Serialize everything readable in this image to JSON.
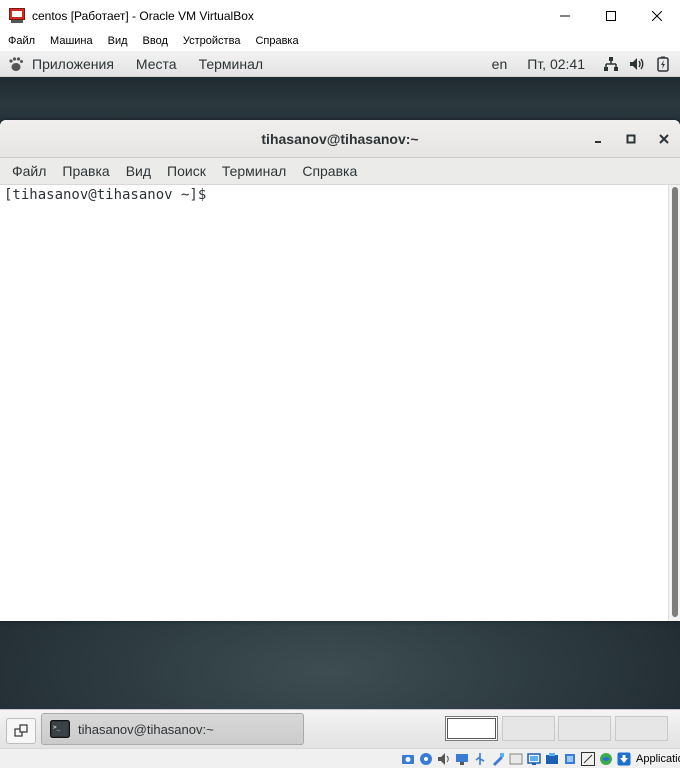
{
  "host_window": {
    "title": "centos [Работает] - Oracle VM VirtualBox",
    "menu": [
      "Файл",
      "Машина",
      "Вид",
      "Ввод",
      "Устройства",
      "Справка"
    ]
  },
  "gnome_top_panel": {
    "menu": [
      "Приложения",
      "Места",
      "Терминал"
    ],
    "language": "en",
    "clock": "Пт, 02:41",
    "status_icons": [
      "network-icon",
      "volume-icon",
      "power-icon"
    ]
  },
  "terminal": {
    "title": "tihasanov@tihasanov:~",
    "menu": [
      "Файл",
      "Правка",
      "Вид",
      "Поиск",
      "Терминал",
      "Справка"
    ],
    "prompt": "[tihasanov@tihasanov ~]$ "
  },
  "gnome_bottom_panel": {
    "task_label": "tihasanov@tihasanov:~",
    "workspace_active": 1,
    "workspace_count": 4
  },
  "host_status": {
    "host_key_label": "Application"
  },
  "colors": {
    "desktop": "#27333a",
    "panel": "#e8e8e8",
    "terminal_bg": "#ffffff",
    "text": "#2e3436"
  }
}
